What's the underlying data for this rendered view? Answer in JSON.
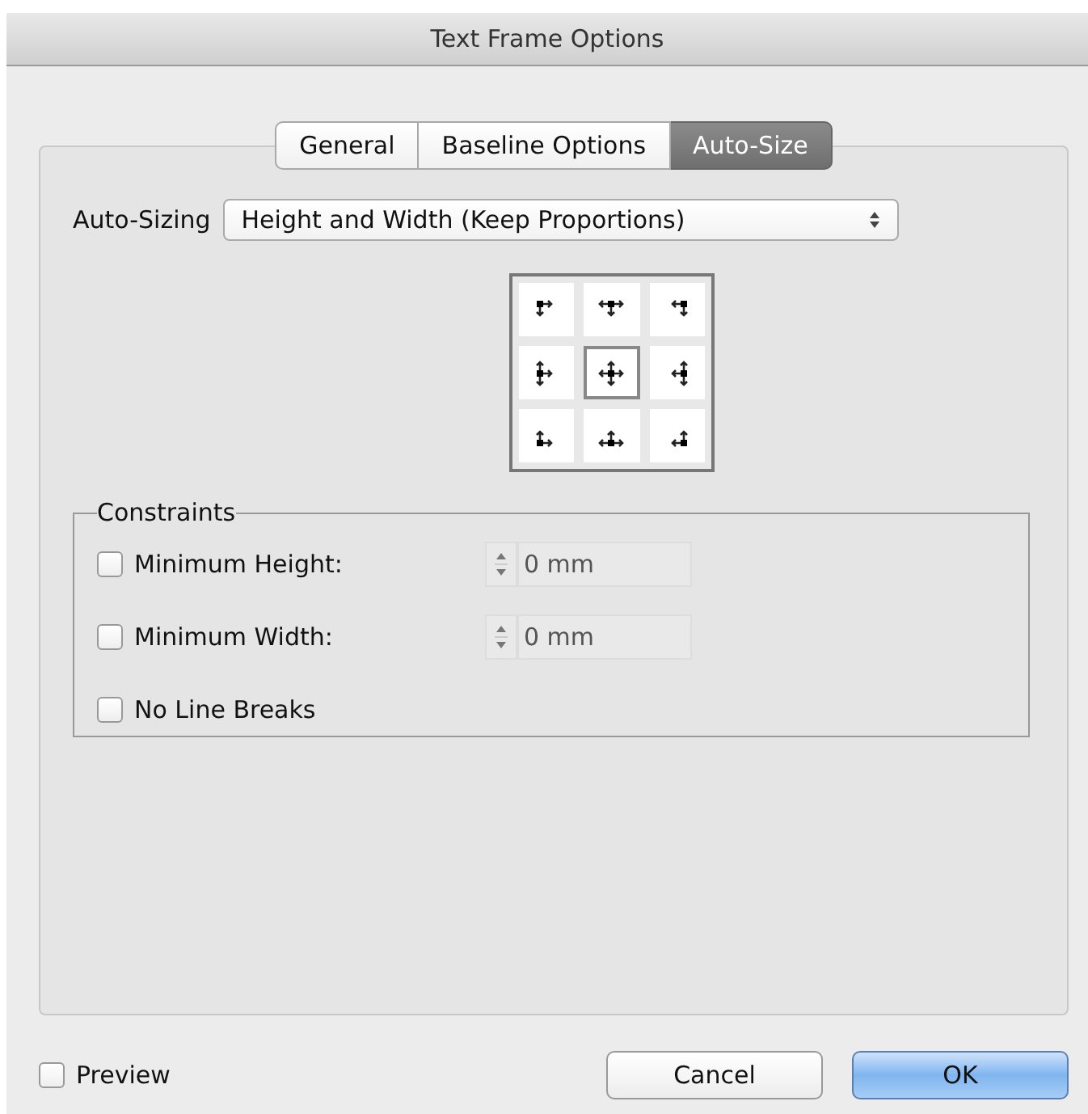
{
  "window": {
    "title": "Text Frame Options"
  },
  "tabs": [
    {
      "label": "General",
      "selected": false
    },
    {
      "label": "Baseline Options",
      "selected": false
    },
    {
      "label": "Auto-Size",
      "selected": true
    }
  ],
  "auto_sizing": {
    "label": "Auto-Sizing",
    "value": "Height and Width (Keep Proportions)"
  },
  "reference_point": {
    "cells": [
      {
        "selected": false
      },
      {
        "selected": false
      },
      {
        "selected": false
      },
      {
        "selected": false
      },
      {
        "selected": true
      },
      {
        "selected": false
      },
      {
        "selected": false
      },
      {
        "selected": false
      },
      {
        "selected": false
      }
    ]
  },
  "constraints": {
    "title": "Constraints",
    "rows": [
      {
        "kind": "stepper",
        "label": "Minimum Height:",
        "checked": false,
        "value": "0 mm",
        "disabled": true
      },
      {
        "kind": "stepper",
        "label": "Minimum Width:",
        "checked": false,
        "value": "0 mm",
        "disabled": true
      },
      {
        "kind": "checkbox",
        "label": "No Line Breaks",
        "checked": false
      }
    ]
  },
  "preview": {
    "label": "Preview",
    "checked": false
  },
  "buttons": [
    {
      "label": "Cancel",
      "kind": "normal"
    },
    {
      "label": "OK",
      "kind": "default"
    }
  ]
}
